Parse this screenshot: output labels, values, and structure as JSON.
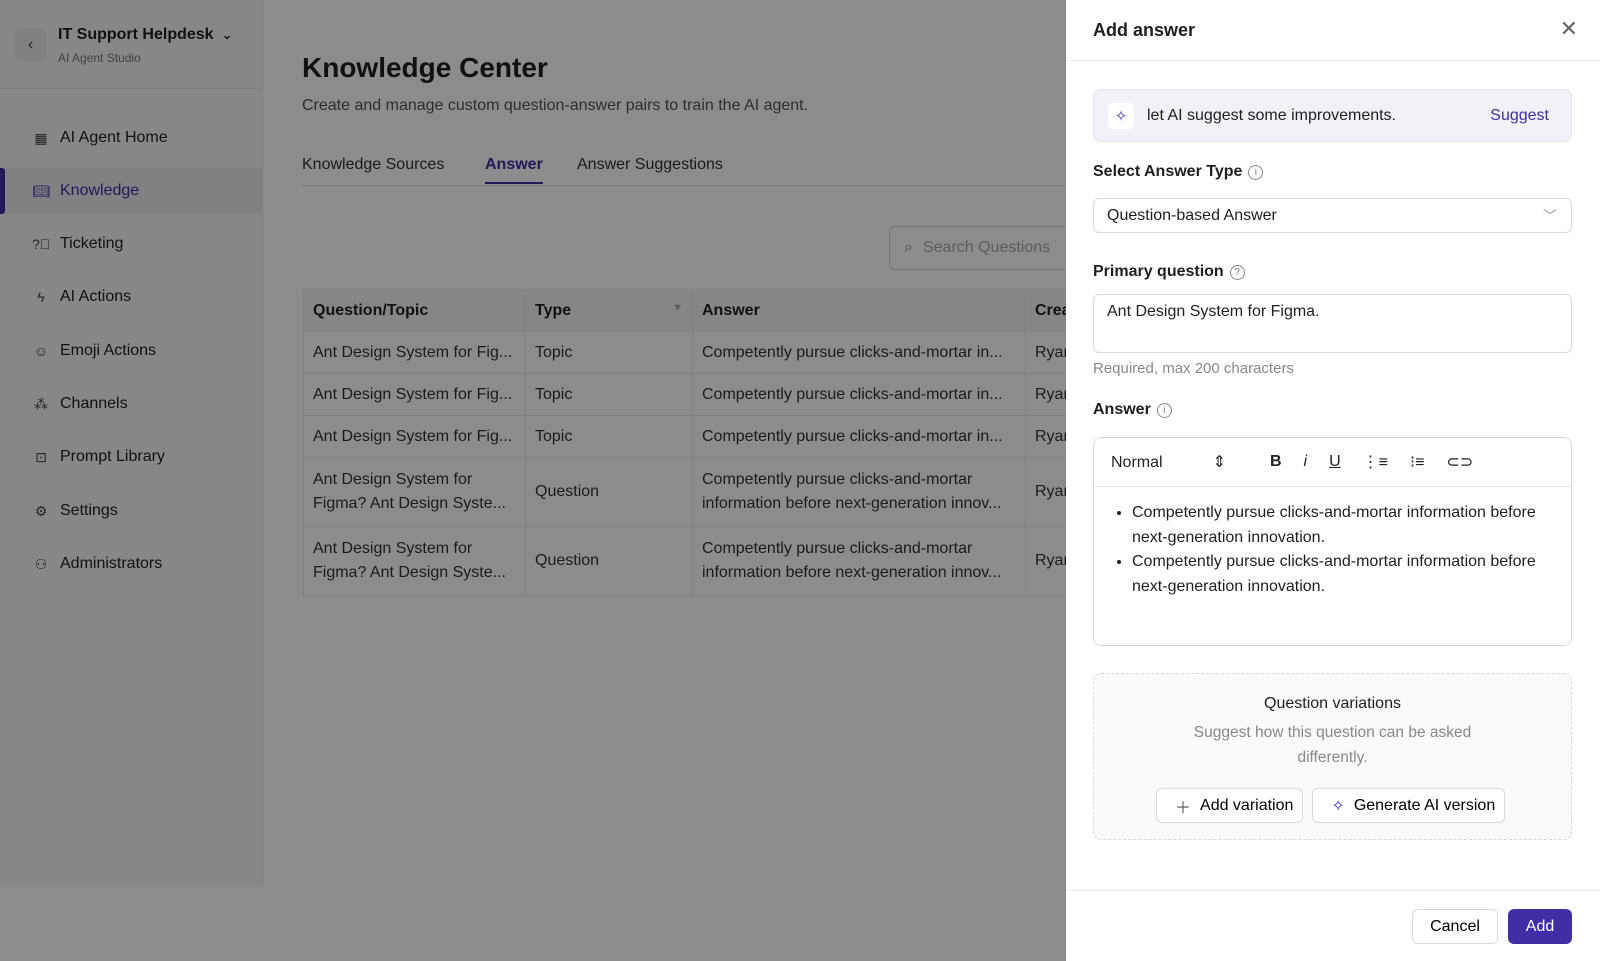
{
  "sidebar": {
    "org": "IT Support Helpdesk",
    "subtitle": "AI Agent Studio",
    "items": [
      {
        "label": "AI Agent Home",
        "icon": "grid-icon"
      },
      {
        "label": "Knowledge",
        "icon": "book-icon"
      },
      {
        "label": "Ticketing",
        "icon": "help-circle-icon"
      },
      {
        "label": "AI Actions",
        "icon": "lightning-icon"
      },
      {
        "label": "Emoji Actions",
        "icon": "smile-icon"
      },
      {
        "label": "Channels",
        "icon": "network-icon"
      },
      {
        "label": "Prompt Library",
        "icon": "terminal-icon"
      },
      {
        "label": "Settings",
        "icon": "gear-icon"
      },
      {
        "label": "Administrators",
        "icon": "user-cog-icon"
      }
    ]
  },
  "main": {
    "title": "Knowledge Center",
    "description": "Create and manage custom question-answer pairs to train the AI agent.",
    "tabs": [
      "Knowledge Sources",
      "Answer",
      "Answer Suggestions"
    ],
    "search_placeholder": "Search Questions",
    "table": {
      "headers": [
        "Question/Topic",
        "Type",
        "Answer",
        "Crea"
      ],
      "rows": [
        [
          "Ant Design System for Fig...",
          "Topic",
          "Competently pursue clicks-and-mortar in...",
          "Ryar"
        ],
        [
          "Ant Design System for Fig...",
          "Topic",
          "Competently pursue clicks-and-mortar in...",
          "Ryar"
        ],
        [
          "Ant Design System for Fig...",
          "Topic",
          "Competently pursue clicks-and-mortar in...",
          "Ryar"
        ],
        [
          "Ant Design System for Figma? Ant Design Syste...",
          "Question",
          "Competently pursue clicks-and-mortar information before next-generation innov...",
          "Ryar"
        ],
        [
          "Ant Design System for Figma? Ant Design Syste...",
          "Question",
          "Competently pursue clicks-and-mortar information before next-generation innov...",
          "Ryar"
        ]
      ]
    }
  },
  "panel": {
    "title": "Add answer",
    "ai_text": "let AI suggest some improvements.",
    "suggest": "Suggest",
    "answer_type_label": "Select Answer Type",
    "answer_type_value": "Question-based Answer",
    "primary_label": "Primary question",
    "primary_value": "Ant Design System for Figma.",
    "primary_help": "Required, max 200 characters",
    "answer_label": "Answer",
    "format": "Normal",
    "answer_items": [
      "Competently pursue clicks-and-mortar information before next-generation innovation.",
      "Competently pursue clicks-and-mortar information before next-generation innovation."
    ],
    "variations": {
      "title": "Question variations",
      "description": "Suggest how this question can be asked differently.",
      "add": "Add variation",
      "generate": "Generate AI version"
    },
    "cancel": "Cancel",
    "add": "Add",
    "accent": "#3f2ea6"
  }
}
